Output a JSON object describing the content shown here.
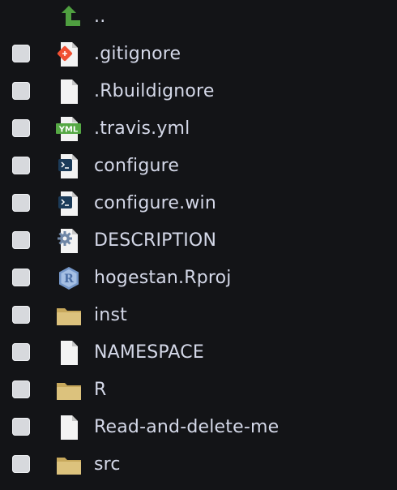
{
  "file_pane": {
    "rows": [
      {
        "name": ".gitignore",
        "icon": "git-file-icon",
        "checkbox": true
      },
      {
        "name": ".Rbuildignore",
        "icon": "blank-file-icon",
        "checkbox": true
      },
      {
        "name": ".travis.yml",
        "icon": "yaml-file-icon",
        "icon_text": "YML",
        "checkbox": true
      },
      {
        "name": "configure",
        "icon": "shell-script-icon",
        "checkbox": true
      },
      {
        "name": "configure.win",
        "icon": "shell-script-icon",
        "checkbox": true
      },
      {
        "name": "DESCRIPTION",
        "icon": "description-gear-icon",
        "checkbox": true
      },
      {
        "name": "hogestan.Rproj",
        "icon": "r-project-icon",
        "icon_text": "R",
        "checkbox": true
      },
      {
        "name": "inst",
        "icon": "folder-icon",
        "checkbox": true
      },
      {
        "name": "NAMESPACE",
        "icon": "blank-file-icon",
        "checkbox": true
      },
      {
        "name": "R",
        "icon": "folder-icon",
        "checkbox": true
      },
      {
        "name": "Read-and-delete-me",
        "icon": "blank-file-icon",
        "checkbox": true
      },
      {
        "name": "src",
        "icon": "folder-icon",
        "checkbox": true
      }
    ],
    "parent_row": {
      "name": "..",
      "icon": "parent-directory-arrow-icon"
    }
  },
  "colors": {
    "background": "#131417",
    "text": "#d4d8e8",
    "checkbox": "#d7d9dd",
    "folder": "#dcc27d",
    "git": "#f05033",
    "yaml": "#55a844",
    "shell": "#1b3b59",
    "r_project": "#7597c9",
    "arrow": "#4f9f40"
  }
}
